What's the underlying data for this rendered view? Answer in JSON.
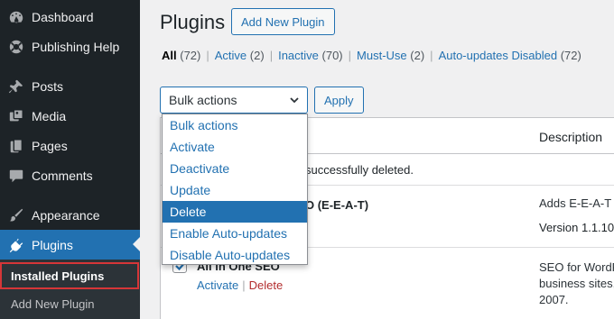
{
  "sidebar": {
    "items": [
      {
        "label": "Dashboard",
        "icon": "dashboard-icon"
      },
      {
        "label": "Publishing Help",
        "icon": "help-icon"
      },
      {
        "label": "Posts",
        "icon": "pin-icon"
      },
      {
        "label": "Media",
        "icon": "media-icon"
      },
      {
        "label": "Pages",
        "icon": "pages-icon"
      },
      {
        "label": "Comments",
        "icon": "comment-icon"
      },
      {
        "label": "Appearance",
        "icon": "brush-icon"
      },
      {
        "label": "Plugins",
        "icon": "plug-icon",
        "active": true
      }
    ],
    "submenu": {
      "installed": "Installed Plugins",
      "add_new": "Add New Plugin"
    }
  },
  "header": {
    "title": "Plugins",
    "add_new_label": "Add New Plugin"
  },
  "filters": [
    {
      "label": "All",
      "count": "(72)",
      "current": true
    },
    {
      "label": "Active",
      "count": "(2)"
    },
    {
      "label": "Inactive",
      "count": "(70)"
    },
    {
      "label": "Must-Use",
      "count": "(2)"
    },
    {
      "label": "Auto-updates Disabled",
      "count": "(72)"
    }
  ],
  "bulk": {
    "selected": "Bulk actions",
    "apply_label": "Apply",
    "options": [
      "Bulk actions",
      "Activate",
      "Deactivate",
      "Update",
      "Delete",
      "Enable Auto-updates",
      "Disable Auto-updates"
    ],
    "highlighted": "Delete"
  },
  "table": {
    "description_header": "Description",
    "notice_text": "successfully deleted.",
    "rows": [
      {
        "name_fragment": "O (E-E-A-T)",
        "desc_line": "Adds E-E-A-T s",
        "version": "Version 1.1.10 |"
      },
      {
        "name": "All in One SEO",
        "actions": [
          "Activate",
          "Delete"
        ],
        "desc_lines": [
          "SEO for WordP",
          "business sites,",
          "2007."
        ],
        "checked": true
      }
    ]
  },
  "colors": {
    "sidebar_bg": "#1d2327",
    "accent": "#2271b1",
    "highlight_border": "#d63638",
    "delete_link": "#b32d2e"
  }
}
